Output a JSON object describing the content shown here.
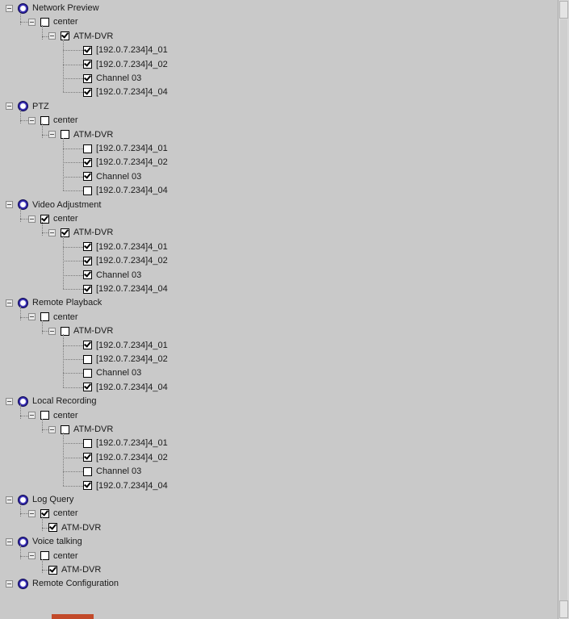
{
  "tree": {
    "groups": [
      {
        "label": "Network Preview",
        "center": {
          "label": "center",
          "checked": false
        },
        "dvr": {
          "label": "ATM-DVR",
          "checked": true
        },
        "channels": [
          {
            "label": "[192.0.7.234]4_01",
            "checked": true
          },
          {
            "label": "[192.0.7.234]4_02",
            "checked": true
          },
          {
            "label": "Channel 03",
            "checked": true
          },
          {
            "label": "[192.0.7.234]4_04",
            "checked": true
          }
        ]
      },
      {
        "label": "PTZ",
        "center": {
          "label": "center",
          "checked": false
        },
        "dvr": {
          "label": "ATM-DVR",
          "checked": false
        },
        "channels": [
          {
            "label": "[192.0.7.234]4_01",
            "checked": false
          },
          {
            "label": "[192.0.7.234]4_02",
            "checked": true
          },
          {
            "label": "Channel 03",
            "checked": true
          },
          {
            "label": "[192.0.7.234]4_04",
            "checked": false
          }
        ]
      },
      {
        "label": "Video Adjustment",
        "center": {
          "label": "center",
          "checked": true
        },
        "dvr": {
          "label": "ATM-DVR",
          "checked": true
        },
        "channels": [
          {
            "label": "[192.0.7.234]4_01",
            "checked": true
          },
          {
            "label": "[192.0.7.234]4_02",
            "checked": true
          },
          {
            "label": "Channel 03",
            "checked": true
          },
          {
            "label": "[192.0.7.234]4_04",
            "checked": true
          }
        ]
      },
      {
        "label": "Remote Playback",
        "center": {
          "label": "center",
          "checked": false
        },
        "dvr": {
          "label": "ATM-DVR",
          "checked": false
        },
        "channels": [
          {
            "label": "[192.0.7.234]4_01",
            "checked": true
          },
          {
            "label": "[192.0.7.234]4_02",
            "checked": false
          },
          {
            "label": "Channel 03",
            "checked": false
          },
          {
            "label": "[192.0.7.234]4_04",
            "checked": true
          }
        ]
      },
      {
        "label": "Local Recording",
        "center": {
          "label": "center",
          "checked": false
        },
        "dvr": {
          "label": "ATM-DVR",
          "checked": false
        },
        "channels": [
          {
            "label": "[192.0.7.234]4_01",
            "checked": false
          },
          {
            "label": "[192.0.7.234]4_02",
            "checked": true
          },
          {
            "label": "Channel 03",
            "checked": false
          },
          {
            "label": "[192.0.7.234]4_04",
            "checked": true
          }
        ]
      },
      {
        "label": "Log Query",
        "center": {
          "label": "center",
          "checked": true
        },
        "dvr": {
          "label": "ATM-DVR",
          "checked": true
        },
        "channels": []
      },
      {
        "label": "Voice talking",
        "center": {
          "label": "center",
          "checked": false
        },
        "dvr": {
          "label": "ATM-DVR",
          "checked": true
        },
        "channels": []
      },
      {
        "label": "Remote Configuration",
        "center": null,
        "dvr": null,
        "channels": []
      }
    ]
  },
  "icons": {
    "group": "permission-circle-icon",
    "expander": "collapse-minus-icon"
  },
  "colors": {
    "background": "#c9c9c9",
    "group_icon": "#2a1fa0",
    "highlight": "#c24a2a"
  }
}
